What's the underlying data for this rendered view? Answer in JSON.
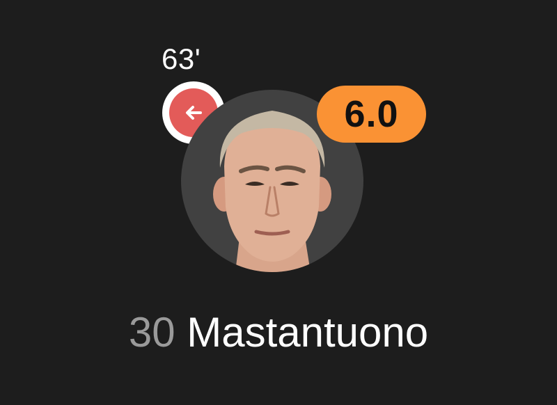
{
  "player": {
    "shirt_number": "30",
    "name": "Mastantuono",
    "rating": "6.0",
    "avatar_icon": "player-photo"
  },
  "substitution": {
    "minute": "63'",
    "icon": "arrow-left-icon",
    "badge_color": "#e35b59"
  },
  "colors": {
    "background": "#1d1d1d",
    "rating_badge": "#fa9234",
    "avatar_bg": "#414141"
  }
}
